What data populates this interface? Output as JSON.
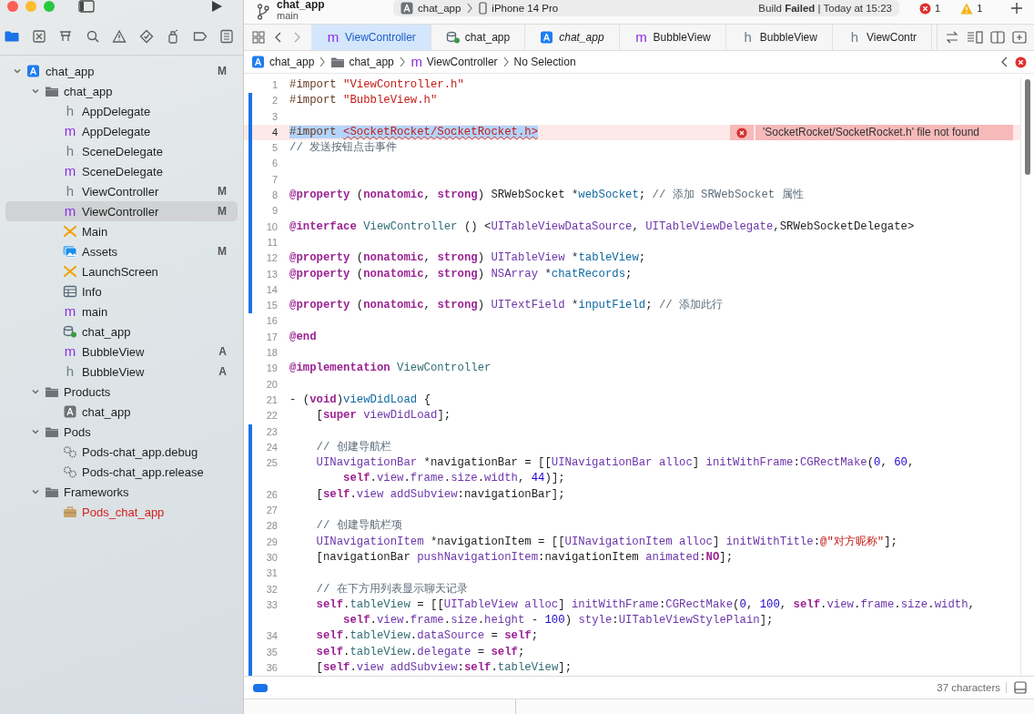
{
  "toolbar": {
    "project_title": "chat_app",
    "branch": "main",
    "scheme": "chat_app",
    "device": "iPhone 14 Pro",
    "build_status": "Build **Failed** | Today at 15:23",
    "errors": "1",
    "warnings": "1"
  },
  "navigator_tabs": [
    {
      "kind": "project",
      "selected": true
    },
    {
      "kind": "source-control",
      "selected": false
    },
    {
      "kind": "symbols",
      "selected": false
    },
    {
      "kind": "find",
      "selected": false
    },
    {
      "kind": "issues",
      "selected": false
    },
    {
      "kind": "tests",
      "selected": false
    },
    {
      "kind": "debug",
      "selected": false
    },
    {
      "kind": "breakpoints",
      "selected": false
    },
    {
      "kind": "reports",
      "selected": false
    }
  ],
  "navigator": [
    {
      "name": "chat_app",
      "kind": "project",
      "badge": "M",
      "selected": false,
      "expanded": true,
      "children": [
        {
          "name": "chat_app",
          "kind": "folder",
          "selected": false,
          "expanded": true,
          "children": [
            {
              "name": "AppDelegate",
              "kind": "h",
              "glyph": "h",
              "selected": false
            },
            {
              "name": "AppDelegate",
              "kind": "m",
              "glyph": "m",
              "selected": false
            },
            {
              "name": "SceneDelegate",
              "kind": "h",
              "glyph": "h",
              "selected": false
            },
            {
              "name": "SceneDelegate",
              "kind": "m",
              "glyph": "m",
              "selected": false
            },
            {
              "name": "ViewController",
              "kind": "h",
              "glyph": "h",
              "badge": "M",
              "selected": false
            },
            {
              "name": "ViewController",
              "kind": "m",
              "glyph": "m",
              "badge": "M",
              "selected": true
            },
            {
              "name": "Main",
              "kind": "storyboard",
              "selected": false
            },
            {
              "name": "Assets",
              "kind": "assets",
              "badge": "M",
              "selected": false
            },
            {
              "name": "LaunchScreen",
              "kind": "storyboard",
              "selected": false
            },
            {
              "name": "Info",
              "kind": "plist",
              "selected": false
            },
            {
              "name": "main",
              "kind": "m",
              "glyph": "m",
              "selected": false
            },
            {
              "name": "chat_app",
              "kind": "datamodel",
              "selected": false
            },
            {
              "name": "BubbleView",
              "kind": "m",
              "glyph": "m",
              "badge": "A",
              "selected": false
            },
            {
              "name": "BubbleView",
              "kind": "h",
              "glyph": "h",
              "badge": "A",
              "selected": false
            }
          ]
        },
        {
          "name": "Products",
          "kind": "folder",
          "selected": false,
          "expanded": true,
          "children": [
            {
              "name": "chat_app",
              "kind": "product",
              "selected": false
            }
          ]
        },
        {
          "name": "Pods",
          "kind": "folder",
          "selected": false,
          "expanded": true,
          "children": [
            {
              "name": "Pods-chat_app.debug",
              "kind": "config",
              "selected": false
            },
            {
              "name": "Pods-chat_app.release",
              "kind": "config",
              "selected": false
            }
          ]
        },
        {
          "name": "Frameworks",
          "kind": "folder",
          "selected": false,
          "expanded": true,
          "children": [
            {
              "name": "Pods_chat_app",
              "kind": "missing-framework",
              "selected": false
            }
          ]
        }
      ]
    }
  ],
  "editor_tabs": [
    {
      "label": "ViewController",
      "kind": "m",
      "glyph": "m",
      "italic": false,
      "selected": true
    },
    {
      "label": "chat_app",
      "kind": "datamodel",
      "italic": false,
      "selected": false
    },
    {
      "label": "chat_app",
      "kind": "project",
      "italic": true,
      "selected": false
    },
    {
      "label": "BubbleView",
      "kind": "m",
      "glyph": "m",
      "italic": false,
      "selected": false
    },
    {
      "label": "BubbleView",
      "kind": "h",
      "glyph": "h",
      "italic": false,
      "selected": false
    },
    {
      "label": "ViewContr",
      "kind": "h",
      "glyph": "h",
      "italic": false,
      "selected": false
    }
  ],
  "breadcrumb": [
    {
      "label": "chat_app",
      "kind": "project"
    },
    {
      "label": "chat_app",
      "kind": "folder"
    },
    {
      "label": "ViewController",
      "kind": "m",
      "glyph": "m"
    },
    {
      "label": "No Selection",
      "kind": "none"
    }
  ],
  "code_lines": [
    {
      "number": "1",
      "changed": false,
      "tokens": [
        {
          "text": "#import ",
          "kind": "directive"
        },
        {
          "text": "\"ViewController.h\"",
          "kind": "string"
        }
      ]
    },
    {
      "number": "2",
      "changed": true,
      "tokens": [
        {
          "text": "#import ",
          "kind": "directive"
        },
        {
          "text": "\"BubbleView.h\"",
          "kind": "string"
        }
      ]
    },
    {
      "number": "3",
      "changed": true
    },
    {
      "number": "4",
      "changed": true,
      "selected": true,
      "error": "'SocketRocket/SocketRocket.h' file not found",
      "tokens": [
        {
          "text": "#import ",
          "kind": "directive"
        },
        {
          "text": "<SocketRocket/SocketRocket.h>",
          "kind": "string"
        }
      ]
    },
    {
      "number": "5",
      "changed": true,
      "tokens": [
        {
          "text": "// 发送按钮点击事件",
          "kind": "comment"
        }
      ]
    },
    {
      "number": "6",
      "changed": true
    },
    {
      "number": "7",
      "changed": true
    },
    {
      "number": "8",
      "changed": true,
      "tokens": [
        {
          "text": "@property",
          "kind": "keyword"
        },
        {
          "text": " (",
          "kind": "plain"
        },
        {
          "text": "nonatomic",
          "kind": "keyword"
        },
        {
          "text": ", ",
          "kind": "plain"
        },
        {
          "text": "strong",
          "kind": "keyword"
        },
        {
          "text": ") SRWebSocket *",
          "kind": "plain"
        },
        {
          "text": "webSocket",
          "kind": "decl"
        },
        {
          "text": "; ",
          "kind": "plain"
        },
        {
          "text": "// 添加 SRWebSocket 属性",
          "kind": "comment"
        }
      ]
    },
    {
      "number": "9",
      "changed": true
    },
    {
      "number": "10",
      "changed": true,
      "tokens": [
        {
          "text": "@interface ",
          "kind": "keyword"
        },
        {
          "text": "ViewController",
          "kind": "project"
        },
        {
          "text": " () <",
          "kind": "plain"
        },
        {
          "text": "UITableViewDataSource",
          "kind": "system"
        },
        {
          "text": ", ",
          "kind": "plain"
        },
        {
          "text": "UITableViewDelegate",
          "kind": "system"
        },
        {
          "text": ",SRWebSocketDelegate>",
          "kind": "plain"
        }
      ]
    },
    {
      "number": "11",
      "changed": true
    },
    {
      "number": "12",
      "changed": true,
      "tokens": [
        {
          "text": "@property",
          "kind": "keyword"
        },
        {
          "text": " (",
          "kind": "plain"
        },
        {
          "text": "nonatomic",
          "kind": "keyword"
        },
        {
          "text": ", ",
          "kind": "plain"
        },
        {
          "text": "strong",
          "kind": "keyword"
        },
        {
          "text": ") ",
          "kind": "plain"
        },
        {
          "text": "UITableView",
          "kind": "system"
        },
        {
          "text": " *",
          "kind": "plain"
        },
        {
          "text": "tableView",
          "kind": "decl"
        },
        {
          "text": ";",
          "kind": "plain"
        }
      ]
    },
    {
      "number": "13",
      "changed": true,
      "tokens": [
        {
          "text": "@property",
          "kind": "keyword"
        },
        {
          "text": " (",
          "kind": "plain"
        },
        {
          "text": "nonatomic",
          "kind": "keyword"
        },
        {
          "text": ", ",
          "kind": "plain"
        },
        {
          "text": "strong",
          "kind": "keyword"
        },
        {
          "text": ") ",
          "kind": "plain"
        },
        {
          "text": "NSArray",
          "kind": "system"
        },
        {
          "text": " *",
          "kind": "plain"
        },
        {
          "text": "chatRecords",
          "kind": "decl"
        },
        {
          "text": ";",
          "kind": "plain"
        }
      ]
    },
    {
      "number": "14",
      "changed": true
    },
    {
      "number": "15",
      "changed": true,
      "tokens": [
        {
          "text": "@property",
          "kind": "keyword"
        },
        {
          "text": " (",
          "kind": "plain"
        },
        {
          "text": "nonatomic",
          "kind": "keyword"
        },
        {
          "text": ", ",
          "kind": "plain"
        },
        {
          "text": "strong",
          "kind": "keyword"
        },
        {
          "text": ") ",
          "kind": "plain"
        },
        {
          "text": "UITextField",
          "kind": "system"
        },
        {
          "text": " *",
          "kind": "plain"
        },
        {
          "text": "inputField",
          "kind": "decl"
        },
        {
          "text": "; ",
          "kind": "plain"
        },
        {
          "text": "// 添加此行",
          "kind": "comment"
        }
      ]
    },
    {
      "number": "16",
      "changed": false
    },
    {
      "number": "17",
      "changed": false,
      "tokens": [
        {
          "text": "@end",
          "kind": "keyword"
        }
      ]
    },
    {
      "number": "18",
      "changed": false
    },
    {
      "number": "19",
      "changed": false,
      "tokens": [
        {
          "text": "@implementation ",
          "kind": "keyword"
        },
        {
          "text": "ViewController",
          "kind": "project"
        }
      ]
    },
    {
      "number": "20",
      "changed": false
    },
    {
      "number": "21",
      "changed": false,
      "tokens": [
        {
          "text": "- (",
          "kind": "plain"
        },
        {
          "text": "void",
          "kind": "keyword"
        },
        {
          "text": ")",
          "kind": "plain"
        },
        {
          "text": "viewDidLoad",
          "kind": "decl"
        },
        {
          "text": " {",
          "kind": "plain"
        }
      ]
    },
    {
      "number": "22",
      "changed": false,
      "tokens": [
        {
          "text": "    [",
          "kind": "plain"
        },
        {
          "text": "super ",
          "kind": "keyword"
        },
        {
          "text": "viewDidLoad",
          "kind": "system"
        },
        {
          "text": "];",
          "kind": "plain"
        }
      ]
    },
    {
      "number": "23",
      "changed": true
    },
    {
      "number": "24",
      "changed": true,
      "tokens": [
        {
          "text": "    // 创建导航栏",
          "kind": "comment"
        }
      ]
    },
    {
      "number": "25",
      "changed": true,
      "tokens": [
        {
          "text": "    UINavigationBar",
          "kind": "system"
        },
        {
          "text": " *navigationBar = [[",
          "kind": "plain"
        },
        {
          "text": "UINavigationBar alloc",
          "kind": "system"
        },
        {
          "text": "] ",
          "kind": "plain"
        },
        {
          "text": "initWithFrame",
          "kind": "system"
        },
        {
          "text": ":",
          "kind": "plain"
        },
        {
          "text": "CGRectMake",
          "kind": "system"
        },
        {
          "text": "(",
          "kind": "plain"
        },
        {
          "text": "0",
          "kind": "number"
        },
        {
          "text": ", ",
          "kind": "plain"
        },
        {
          "text": "60",
          "kind": "number"
        },
        {
          "text": ",",
          "kind": "plain"
        }
      ],
      "wrap": [
        {
          "text": "self",
          "kind": "keyword"
        },
        {
          "text": ".",
          "kind": "plain"
        },
        {
          "text": "view",
          "kind": "system"
        },
        {
          "text": ".",
          "kind": "plain"
        },
        {
          "text": "frame",
          "kind": "system"
        },
        {
          "text": ".",
          "kind": "plain"
        },
        {
          "text": "size",
          "kind": "system"
        },
        {
          "text": ".",
          "kind": "plain"
        },
        {
          "text": "width",
          "kind": "system"
        },
        {
          "text": ", ",
          "kind": "plain"
        },
        {
          "text": "44",
          "kind": "number"
        },
        {
          "text": ")];",
          "kind": "plain"
        }
      ]
    },
    {
      "number": "26",
      "changed": true,
      "tokens": [
        {
          "text": "    [",
          "kind": "plain"
        },
        {
          "text": "self",
          "kind": "keyword"
        },
        {
          "text": ".",
          "kind": "plain"
        },
        {
          "text": "view addSubview",
          "kind": "system"
        },
        {
          "text": ":navigationBar];",
          "kind": "plain"
        }
      ]
    },
    {
      "number": "27",
      "changed": true
    },
    {
      "number": "28",
      "changed": true,
      "tokens": [
        {
          "text": "    // 创建导航栏项",
          "kind": "comment"
        }
      ]
    },
    {
      "number": "29",
      "changed": true,
      "tokens": [
        {
          "text": "    UINavigationItem",
          "kind": "system"
        },
        {
          "text": " *navigationItem = [[",
          "kind": "plain"
        },
        {
          "text": "UINavigationItem alloc",
          "kind": "system"
        },
        {
          "text": "] ",
          "kind": "plain"
        },
        {
          "text": "initWithTitle",
          "kind": "system"
        },
        {
          "text": ":",
          "kind": "plain"
        },
        {
          "text": "@\"对方昵称\"",
          "kind": "string"
        },
        {
          "text": "];",
          "kind": "plain"
        }
      ]
    },
    {
      "number": "30",
      "changed": true,
      "tokens": [
        {
          "text": "    [navigationBar ",
          "kind": "plain"
        },
        {
          "text": "pushNavigationItem",
          "kind": "system"
        },
        {
          "text": ":navigationItem ",
          "kind": "plain"
        },
        {
          "text": "animated",
          "kind": "system"
        },
        {
          "text": ":",
          "kind": "plain"
        },
        {
          "text": "NO",
          "kind": "keyword"
        },
        {
          "text": "];",
          "kind": "plain"
        }
      ]
    },
    {
      "number": "31",
      "changed": true
    },
    {
      "number": "32",
      "changed": true,
      "tokens": [
        {
          "text": "    // 在下方用列表显示聊天记录",
          "kind": "comment"
        }
      ]
    },
    {
      "number": "33",
      "changed": true,
      "tokens": [
        {
          "text": "    self",
          "kind": "keyword"
        },
        {
          "text": ".",
          "kind": "plain"
        },
        {
          "text": "tableView",
          "kind": "project"
        },
        {
          "text": " = [[",
          "kind": "plain"
        },
        {
          "text": "UITableView alloc",
          "kind": "system"
        },
        {
          "text": "] ",
          "kind": "plain"
        },
        {
          "text": "initWithFrame",
          "kind": "system"
        },
        {
          "text": ":",
          "kind": "plain"
        },
        {
          "text": "CGRectMake",
          "kind": "system"
        },
        {
          "text": "(",
          "kind": "plain"
        },
        {
          "text": "0",
          "kind": "number"
        },
        {
          "text": ", ",
          "kind": "plain"
        },
        {
          "text": "100",
          "kind": "number"
        },
        {
          "text": ", ",
          "kind": "plain"
        },
        {
          "text": "self",
          "kind": "keyword"
        },
        {
          "text": ".",
          "kind": "plain"
        },
        {
          "text": "view",
          "kind": "system"
        },
        {
          "text": ".",
          "kind": "plain"
        },
        {
          "text": "frame",
          "kind": "system"
        },
        {
          "text": ".",
          "kind": "plain"
        },
        {
          "text": "size",
          "kind": "system"
        },
        {
          "text": ".",
          "kind": "plain"
        },
        {
          "text": "width",
          "kind": "system"
        },
        {
          "text": ",",
          "kind": "plain"
        }
      ],
      "wrap": [
        {
          "text": "self",
          "kind": "keyword"
        },
        {
          "text": ".",
          "kind": "plain"
        },
        {
          "text": "view",
          "kind": "system"
        },
        {
          "text": ".",
          "kind": "plain"
        },
        {
          "text": "frame",
          "kind": "system"
        },
        {
          "text": ".",
          "kind": "plain"
        },
        {
          "text": "size",
          "kind": "system"
        },
        {
          "text": ".",
          "kind": "plain"
        },
        {
          "text": "height",
          "kind": "system"
        },
        {
          "text": " - ",
          "kind": "plain"
        },
        {
          "text": "100",
          "kind": "number"
        },
        {
          "text": ") ",
          "kind": "plain"
        },
        {
          "text": "style",
          "kind": "system"
        },
        {
          "text": ":",
          "kind": "plain"
        },
        {
          "text": "UITableViewStylePlain",
          "kind": "system"
        },
        {
          "text": "];",
          "kind": "plain"
        }
      ]
    },
    {
      "number": "34",
      "changed": true,
      "tokens": [
        {
          "text": "    self",
          "kind": "keyword"
        },
        {
          "text": ".",
          "kind": "plain"
        },
        {
          "text": "tableView",
          "kind": "project"
        },
        {
          "text": ".",
          "kind": "plain"
        },
        {
          "text": "dataSource",
          "kind": "system"
        },
        {
          "text": " = ",
          "kind": "plain"
        },
        {
          "text": "self",
          "kind": "keyword"
        },
        {
          "text": ";",
          "kind": "plain"
        }
      ]
    },
    {
      "number": "35",
      "changed": true,
      "tokens": [
        {
          "text": "    self",
          "kind": "keyword"
        },
        {
          "text": ".",
          "kind": "plain"
        },
        {
          "text": "tableView",
          "kind": "project"
        },
        {
          "text": ".",
          "kind": "plain"
        },
        {
          "text": "delegate",
          "kind": "system"
        },
        {
          "text": " = ",
          "kind": "plain"
        },
        {
          "text": "self",
          "kind": "keyword"
        },
        {
          "text": ";",
          "kind": "plain"
        }
      ]
    },
    {
      "number": "36",
      "changed": true,
      "tokens": [
        {
          "text": "    [",
          "kind": "plain"
        },
        {
          "text": "self",
          "kind": "keyword"
        },
        {
          "text": ".",
          "kind": "plain"
        },
        {
          "text": "view addSubview",
          "kind": "system"
        },
        {
          "text": ":",
          "kind": "plain"
        },
        {
          "text": "self",
          "kind": "keyword"
        },
        {
          "text": ".",
          "kind": "plain"
        },
        {
          "text": "tableView",
          "kind": "project"
        },
        {
          "text": "];",
          "kind": "plain"
        }
      ]
    }
  ],
  "status_bar": {
    "debug_area_visible": true,
    "info": "37 characters"
  }
}
